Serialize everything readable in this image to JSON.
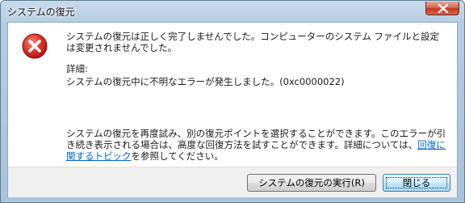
{
  "window": {
    "title": "システムの復元"
  },
  "message": {
    "main": "システムの復元は正しく完了しませんでした。コンピューターのシステム ファイルと設定は変更されませんでした。",
    "details_label": "詳細:",
    "details_text": "システムの復元中に不明なエラーが発生しました。(0xc0000022)",
    "hint_before": "システムの復元を再度試み、別の復元ポイントを選択することができます。このエラーが引き続き表示される場合は、高度な回復方法を試すことができます。詳細については、",
    "hint_link": "回復に関するトピック",
    "hint_after": "を参照してください。"
  },
  "buttons": {
    "run_label": "システムの復元の実行(R)",
    "close_label": "閉じる"
  },
  "colors": {
    "link": "#0066cc",
    "error_icon": "#d0312d"
  },
  "icons": {
    "error": "error-icon",
    "close": "close-icon"
  }
}
